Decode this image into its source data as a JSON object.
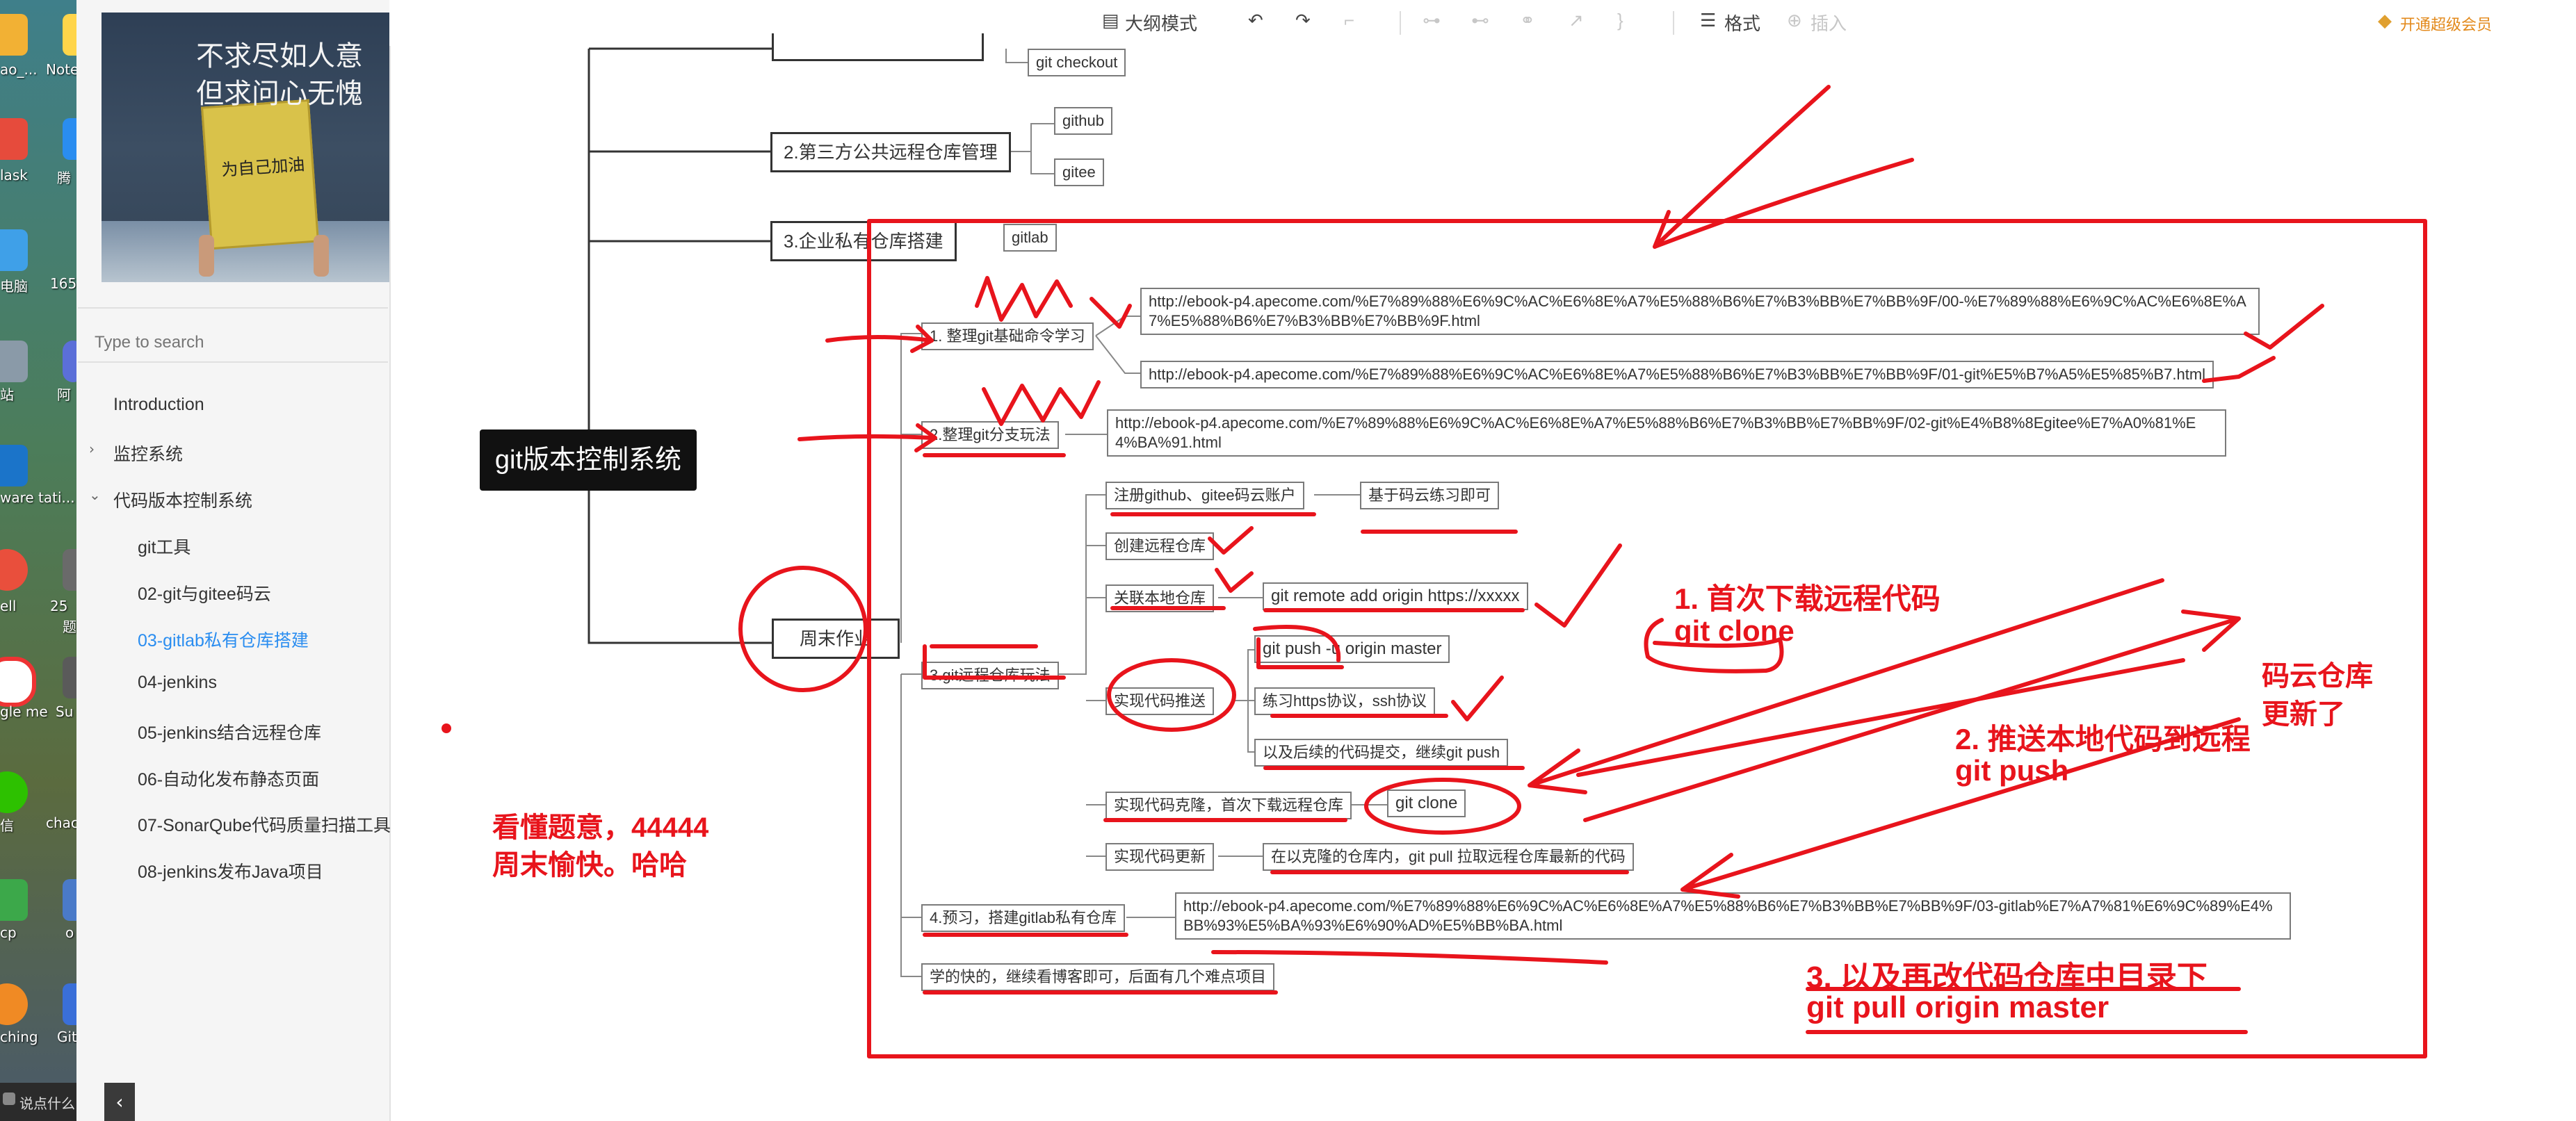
{
  "desktop": {
    "labels": [
      "ao_...",
      "Note",
      "lask",
      "腾",
      "电脑",
      "165",
      "站",
      "阿",
      "ware\ntati...",
      "ell",
      "25",
      "题",
      "gle\nme",
      "Su\nTe",
      "信",
      "chac",
      "cp",
      "o",
      "ching",
      "Git"
    ],
    "taskbar_text": "说点什么..."
  },
  "sidebar": {
    "cover_text_line1": "不求尽如人意",
    "cover_text_line2": "但求问心无愧",
    "cover_sign": "为自己加油",
    "search_placeholder": "Type to search",
    "items": [
      {
        "label": "Introduction"
      },
      {
        "label": "监控系统"
      },
      {
        "label": "代码版本控制系统"
      },
      {
        "label": "git工具"
      },
      {
        "label": "02-git与gitee码云"
      },
      {
        "label": "03-gitlab私有仓库搭建"
      },
      {
        "label": "04-jenkins"
      },
      {
        "label": "05-jenkins结合远程仓库"
      },
      {
        "label": "06-自动化发布静态页面"
      },
      {
        "label": "07-SonarQube代码质量扫描工具"
      },
      {
        "label": "08-jenkins发布Java项目"
      }
    ],
    "collapse_icon": "chevron-left-icon"
  },
  "toolbar": {
    "outline_mode": "大纲模式",
    "format": "格式",
    "insert": "插入",
    "vip": "开通超级会员"
  },
  "mindmap": {
    "root": "git版本控制系统",
    "branch_git_checkout": "git checkout",
    "branch2": "2.第三方公共远程仓库管理",
    "github": "github",
    "gitee": "gitee",
    "branch3": "3.企业私有仓库搭建",
    "gitlab": "gitlab",
    "weekend": "周末作业",
    "h1": "1. 整理git基础命令学习",
    "url1": "http://ebook-p4.apecome.com/%E7%89%88%E6%9C%AC%E6%8E%A7%E5%88%B6%E7%B3%BB%E7%BB%9F/00-%E7%89%88%E6%9C%AC%E6%8E%A7%E5%88%B6%E7%B3%BB%E7%BB%9F.html",
    "url2": "http://ebook-p4.apecome.com/%E7%89%88%E6%9C%AC%E6%8E%A7%E5%88%B6%E7%B3%BB%E7%BB%9F/01-git%E5%B7%A5%E5%85%B7.html",
    "h2": "2.整理git分支玩法",
    "url3": "http://ebook-p4.apecome.com/%E7%89%88%E6%9C%AC%E6%8E%A7%E5%88%B6%E7%B3%BB%E7%BB%9F/02-git%E4%B8%8Egitee%E7%A0%81%E4%BA%91.html",
    "h3": "3.git远程仓库玩法",
    "s_register": "注册github、gitee码云账户",
    "s_register_note": "基于码云练习即可",
    "s_create": "创建远程仓库",
    "s_link": "关联本地仓库",
    "s_link_cmd": "git remote add origin https://xxxxx",
    "s_push": "实现代码推送",
    "s_push_cmd": "git push -u origin master",
    "s_push_proto": "练习https协议，ssh协议",
    "s_push_later": "以及后续的代码提交，继续git push",
    "s_clone": "实现代码克隆，首次下载远程仓库",
    "s_clone_cmd": "git clone",
    "s_update": "实现代码更新",
    "s_update_note": "在以克隆的仓库内，git pull 拉取远程仓库最新的代码",
    "h4": "4.预习，搭建gitlab私有仓库",
    "url4": "http://ebook-p4.apecome.com/%E7%89%88%E6%9C%AC%E6%8E%A7%E5%88%B6%E7%B3%BB%E7%BB%9F/03-gitlab%E7%A7%81%E6%9C%89%E4%BB%93%E5%BA%93%E6%90%AD%E5%BB%BA.html",
    "h5": "学的快的，继续看博客即可，后面有几个难点项目"
  },
  "annotations": {
    "a1_line1": "1. 首次下载远程代码",
    "a1_line2": "git clone",
    "a2_line1": "2. 推送本地代码到远程",
    "a2_line2": "git push",
    "a3_line1": "3. 以及再改代码仓库中目录下",
    "a3_line2": "git pull origin master",
    "cloud_line1": "码云仓库",
    "cloud_line2": "更新了",
    "left_line1": "看懂题意，44444",
    "left_line2": "周末愉快。哈哈"
  },
  "colors": {
    "annotation_red": "#e8141c",
    "link_blue": "#2a8df0",
    "root_bg": "#111111"
  }
}
